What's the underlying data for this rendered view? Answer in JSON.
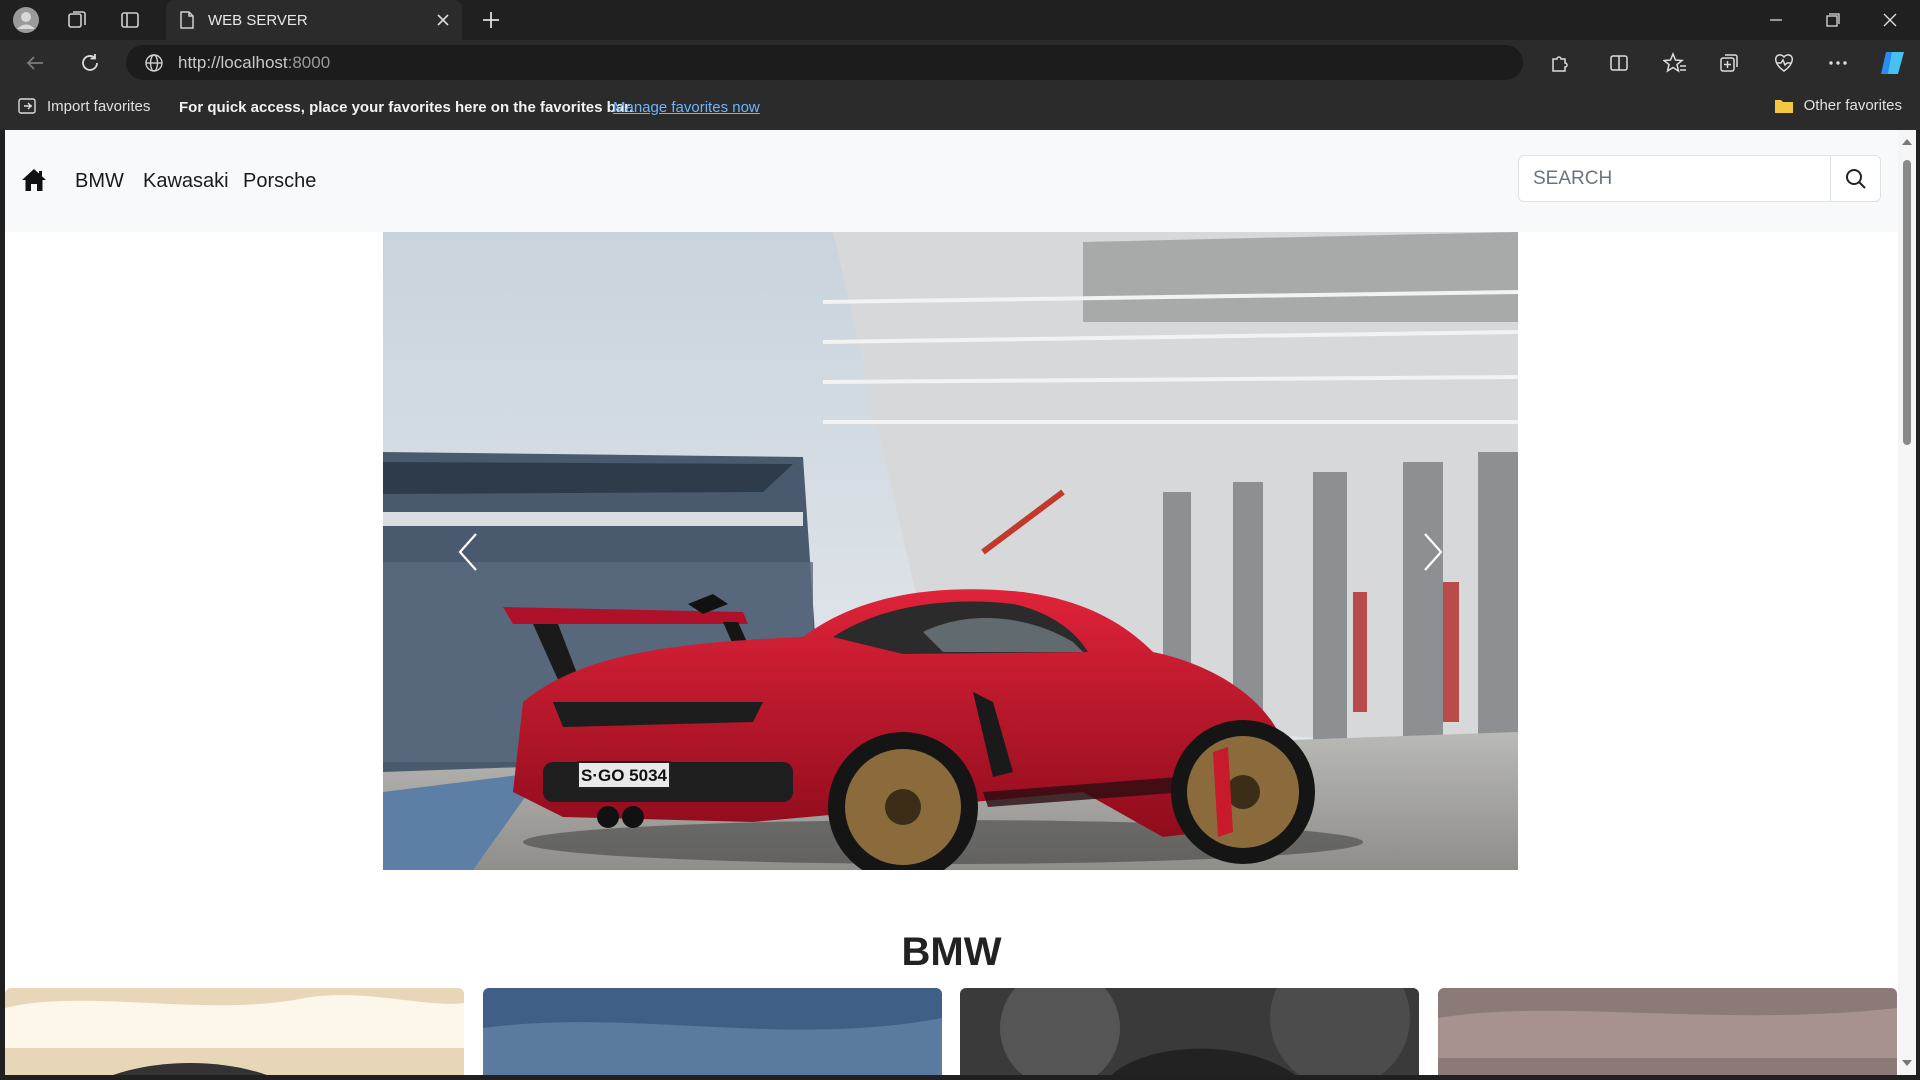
{
  "browser": {
    "tab_title": "WEB SERVER",
    "url_host": "http://localhost",
    "url_port": ":8000",
    "favorites_bar": {
      "import_label": "Import favorites",
      "message": "For quick access, place your favorites here on the favorites bar.",
      "manage_link": "Manage favorites now",
      "other_label": "Other favorites"
    }
  },
  "navbar": {
    "links": [
      "BMW",
      "Kawasaki",
      "Porsche"
    ],
    "search_placeholder": "SEARCH"
  },
  "carousel": {
    "plate": "S·GO 5034",
    "prev_icon": "chevron-left-icon",
    "next_icon": "chevron-right-icon"
  },
  "sections": [
    {
      "title": "BMW"
    }
  ],
  "colors": {
    "car_red": "#c8102e",
    "link_blue": "#6cb4ff"
  }
}
